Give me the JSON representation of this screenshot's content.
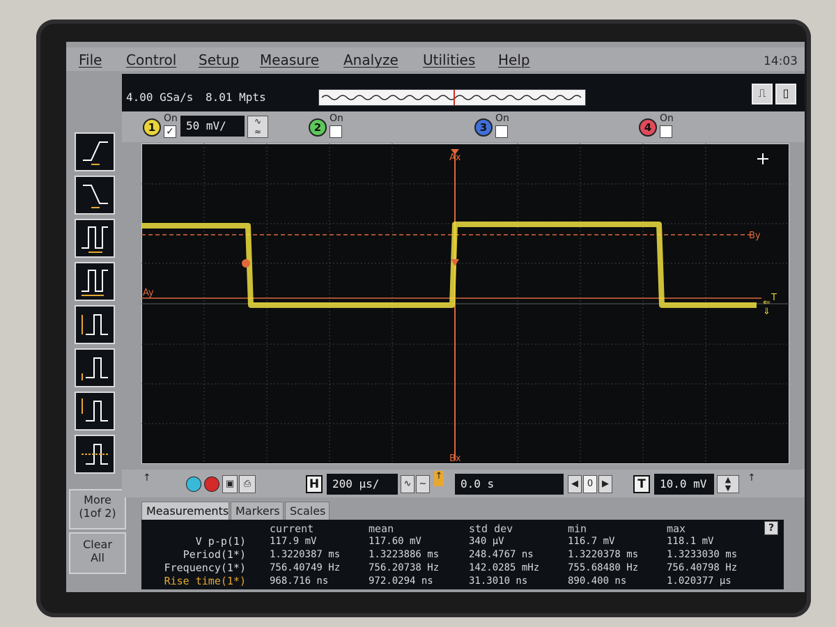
{
  "menu": [
    "File",
    "Control",
    "Setup",
    "Measure",
    "Analyze",
    "Utilities",
    "Help"
  ],
  "clock": "14:03",
  "status": {
    "sample_rate": "4.00 GSa/s",
    "memory_depth": "8.01 Mpts"
  },
  "channels": [
    {
      "number": "1",
      "on_label": "On",
      "checked": true,
      "scale": "50 mV/",
      "color": "#e8d43a"
    },
    {
      "number": "2",
      "on_label": "On",
      "checked": false,
      "color": "#5cc95a"
    },
    {
      "number": "3",
      "on_label": "On",
      "checked": false,
      "color": "#3f6fd8"
    },
    {
      "number": "4",
      "on_label": "On",
      "checked": false,
      "color": "#e04a5a"
    }
  ],
  "waveform": {
    "color": "#f0e040",
    "marker_labels": {
      "a_x": "Ax",
      "b_x": "Bx",
      "a_y": "Ay",
      "b_y": "By",
      "trigger": "T"
    }
  },
  "timebase": {
    "h_label": "H",
    "scale": "200 µs/",
    "delay": "0.0 s",
    "nav_value": "0",
    "trigger_label": "T",
    "trigger_level": "10.0 mV"
  },
  "side_buttons": {
    "more": [
      "More",
      "(1of 2)"
    ],
    "clear": [
      "Clear",
      "All"
    ]
  },
  "tabs": [
    "Measurements",
    "Markers",
    "Scales"
  ],
  "measurements": {
    "headers": [
      "current",
      "mean",
      "std dev",
      "min",
      "max"
    ],
    "rows": [
      {
        "name": "V p-p(1)",
        "values": [
          "117.9 mV",
          "117.60 mV",
          "340 µV",
          "116.7 mV",
          "118.1 mV"
        ],
        "highlight": false
      },
      {
        "name": "Period(1*)",
        "values": [
          "1.3220387 ms",
          "1.3223886 ms",
          "248.4767 ns",
          "1.3220378 ms",
          "1.3233030 ms"
        ],
        "highlight": false
      },
      {
        "name": "Frequency(1*)",
        "values": [
          "756.40749 Hz",
          "756.20738 Hz",
          "142.0285 mHz",
          "755.68480 Hz",
          "756.40798 Hz"
        ],
        "highlight": false
      },
      {
        "name": "Rise time(1*)",
        "values": [
          "968.716 ns",
          "972.0294 ns",
          "31.3010 ns",
          "890.400 ns",
          "1.020377 µs"
        ],
        "highlight": true
      }
    ]
  },
  "help_label": "?"
}
